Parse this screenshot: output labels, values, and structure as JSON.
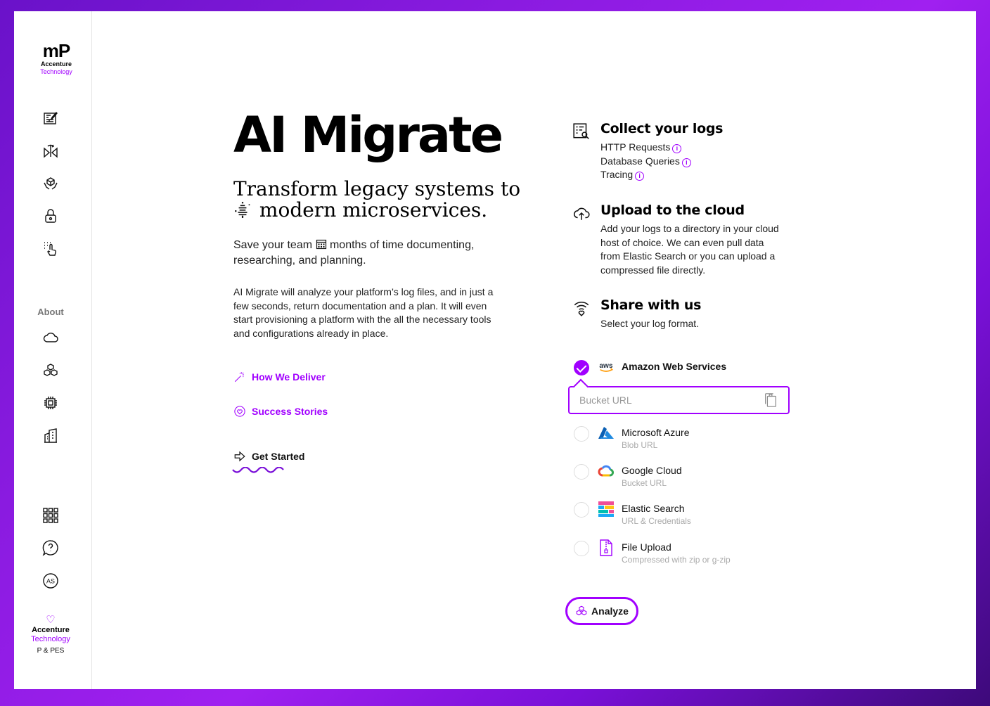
{
  "sidebar": {
    "logo_mark": "mP",
    "logo_line1": "Accenture",
    "logo_line2": "Technology",
    "about_label": "About",
    "footer": {
      "heart": "♡",
      "line1": "Accenture",
      "line2": "Technology",
      "line3": "P & PES"
    }
  },
  "hero": {
    "title": "AI Migrate",
    "subtitle_line1": "Transform legacy systems to",
    "subtitle_line2": "modern microservices.",
    "lead_part1": "Save your team",
    "lead_part2": "months of time documenting, researching, and planning.",
    "body": "AI Migrate will analyze your platform’s log files, and in just a few seconds, return documentation and a plan. It will even start provisioning a platform with the all the necessary tools and configurations already in place."
  },
  "links": {
    "how_we_deliver": "How We Deliver",
    "success_stories": "Success Stories",
    "get_started": "Get Started"
  },
  "steps": {
    "collect": {
      "title": "Collect your logs",
      "items": [
        "HTTP Requests",
        "Database Queries",
        "Tracing"
      ]
    },
    "upload": {
      "title": "Upload to the cloud",
      "body": "Add your logs to a directory in your cloud host of choice. We can even pull data from Elastic Search or you can upload a compressed file directly."
    },
    "share": {
      "title": "Share with us",
      "body": "Select your log format."
    }
  },
  "providers": [
    {
      "name": "Amazon Web Services",
      "sub": "",
      "selected": true,
      "logo_icon": "aws-icon"
    },
    {
      "name": "Microsoft Azure",
      "sub": "Blob URL",
      "selected": false,
      "logo_icon": "azure-icon"
    },
    {
      "name": "Google Cloud",
      "sub": "Bucket URL",
      "selected": false,
      "logo_icon": "google-cloud-icon"
    },
    {
      "name": "Elastic Search",
      "sub": "URL & Credentials",
      "selected": false,
      "logo_icon": "elastic-icon"
    },
    {
      "name": "File Upload",
      "sub": "Compressed with zip or g-zip",
      "selected": false,
      "logo_icon": "zip-file-icon"
    }
  ],
  "bucket_input": {
    "placeholder": "Bucket URL",
    "value": ""
  },
  "aws_logo_text": "aws",
  "analyze_label": "Analyze",
  "colors": {
    "accent": "#a100ff",
    "text": "#111111",
    "muted": "#aaaaaa"
  }
}
